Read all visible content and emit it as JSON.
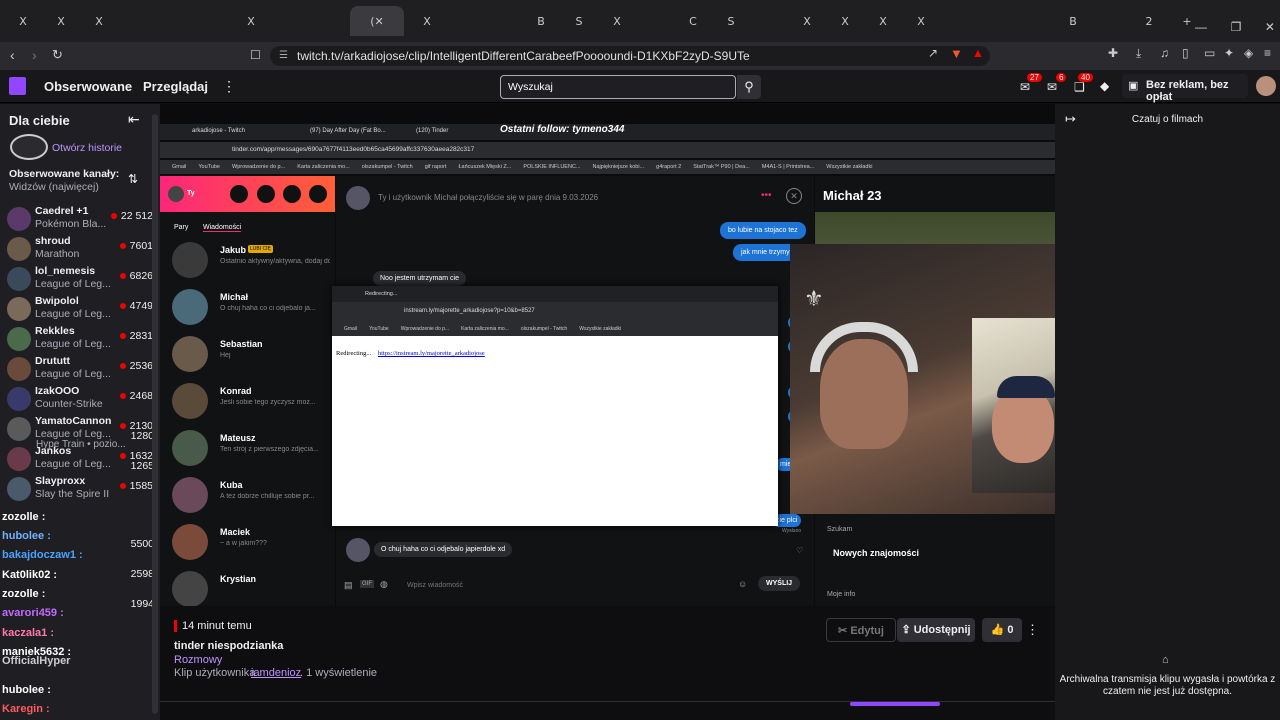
{
  "browser": {
    "tabs": [
      "X",
      "X",
      "X",
      "",
      "",
      "",
      "X",
      "",
      "",
      "X",
      "",
      "",
      "B",
      "S",
      "X",
      "",
      "C",
      "S",
      "",
      "X",
      "X",
      "X",
      "X",
      "",
      "",
      "",
      "B",
      "",
      "2"
    ],
    "active_tab_label": "(",
    "new_tab": "+",
    "url": "twitch.tv/arkadiojose/clip/IntelligentDifferentCarabeefPooooundi-D1KXbF2zyD-S9UTe",
    "window_min": "—",
    "window_max": "❐",
    "window_close": "✕"
  },
  "twitch": {
    "nav": {
      "following": "Obserwowane",
      "browse": "Przeglądaj",
      "more": "⋮"
    },
    "search_placeholder": "Wyszukaj",
    "badges": {
      "notifications": "27",
      "whispers": "6",
      "prime": "40"
    },
    "adfree": "Bez reklam, bez opłat",
    "sidebar": {
      "title": "Dla ciebie",
      "history": "Otwórz historie",
      "followed_heading": "Obserwowane kanały:",
      "sort": "Widzów (najwięcej)",
      "channels": [
        {
          "name": "Caedrel +1",
          "game": "Pokémon Bla...",
          "viewers": "22 512"
        },
        {
          "name": "shroud",
          "game": "Marathon",
          "viewers": "7601"
        },
        {
          "name": "lol_nemesis",
          "game": "League of Leg...",
          "viewers": "6826"
        },
        {
          "name": "Bwipolol",
          "game": "League of Leg...",
          "viewers": "4749"
        },
        {
          "name": "Rekkles",
          "game": "League of Leg...",
          "viewers": "2831"
        },
        {
          "name": "Drututt",
          "game": "League of Leg...",
          "viewers": "2536"
        },
        {
          "name": "IzakOOO",
          "game": "Counter-Strike",
          "viewers": "2468"
        },
        {
          "name": "YamatoCannon",
          "game": "League of Leg...",
          "viewers": "2130"
        },
        {
          "name": "Jankos",
          "game": "League of Leg...",
          "viewers": "1632"
        },
        {
          "name": "Slayproxx",
          "game": "Slay the Spire II",
          "viewers": "1585"
        }
      ],
      "hype_train": "Hype Train • pozio...",
      "extra_viewers": [
        "1280",
        "1265",
        "5500",
        "2598",
        "1994"
      ],
      "overlay_chat": [
        "zozolle :",
        "hubolee :",
        "bakajdoczaw1 :",
        "Kat0lik02 :",
        "zozolle :",
        "avarori459 :",
        "kaczala1 :",
        "maniek5632 :",
        "OfficialHyper",
        "hubolee :",
        "Karegin :"
      ]
    },
    "clip": {
      "time": "14 minut temu",
      "title": "tinder niespodzianka",
      "category": "Rozmowy",
      "author_prefix": "Klip użytkownika",
      "author": "iamdenioz",
      "views": ". 1 wyświetlenie",
      "edit": "Edytuj",
      "share": "Udostępnij",
      "likes": "0"
    },
    "right": {
      "title": "Czatuj o filmach",
      "archived": "Archiwalna transmisja klipu wygasła i powtórka z czatem nie jest już dostępna."
    }
  },
  "stream": {
    "follow_banner": "Ostatni follow: tymeno344",
    "inner_tabs": [
      "arkadiojose - Twitch",
      "(97) Day After Day (Fat Bo...",
      "(120) Tinder"
    ],
    "inner_url": "tinder.com/app/messages/690a7677f4113eed0b65ca45699affc337630aeea282c317",
    "bookmarks": [
      "Gmail",
      "YouTube",
      "Wprowadzenie do p...",
      "Karta zaliczenia mo...",
      "olszakumpel - Twitch",
      "gif raport",
      "Łańcuszek Mięski Z...",
      "POLSKIE INFLUENC...",
      "Najpiękniejsze kobi...",
      "g4raport 2",
      "StatTrak™ P90 | Dea...",
      "M4A1-S | Printstrea...",
      "Wszystkie zakładki"
    ],
    "tinder": {
      "me": "Ty",
      "tabs": [
        "Pary",
        "Wiadomości"
      ],
      "matches": [
        {
          "name": "Jakub",
          "badge": "LUBI CIĘ",
          "preview": "Ostatnio aktywny/aktywna, dodaj do par już teraz!"
        },
        {
          "name": "Michał",
          "preview": "O chuj haha co ci odjebalo ja..."
        },
        {
          "name": "Sebastian",
          "preview": "Hej"
        },
        {
          "name": "Konrad",
          "preview": "Jeśli sobie tego życzysz moż..."
        },
        {
          "name": "Mateusz",
          "preview": "Ten strój z pierwszego zdjęcia..."
        },
        {
          "name": "Kuba",
          "preview": "A tez dobrze chilluje sobie pr..."
        },
        {
          "name": "Maciek",
          "preview": "~ a w jakim???"
        },
        {
          "name": "Krystian",
          "preview": ""
        }
      ],
      "match_info": "Ty i użytkownik Michał połączyliście się w parę dnia 9.03.2026",
      "messages_out": [
        "bo lubie na stojaco tez",
        "jak mnie trzymy"
      ],
      "message_in": "Noo jestem utrzymam cie",
      "last_message": "O chuj haha co ci odjebalo japierdole xd",
      "partial_right": [
        "plu",
        "tatu",
        "sul",
        "odr",
        "miejscu",
        "cie plci"
      ],
      "sent_label": "Wysłano",
      "compose_placeholder": "Wpisz wiadomość",
      "send": "WYŚLIJ",
      "profile_name": "Michał 23",
      "looking_for_label": "Szukam",
      "looking_for": "Nowych znajomości",
      "more_info": "Moje info"
    },
    "popup": {
      "tab": "Redirecting...",
      "url": "instream.ly/majorette_arkadiojose?p=10&b=8527",
      "bookmarks": [
        "Gmail",
        "YouTube",
        "Wprowadzenie do p...",
        "Karta zaliczenia mo...",
        "olszakumpel - Twitch",
        "Wszystkie zakładki"
      ],
      "text": "Redirecting...",
      "link": "https://instream.ly/majorette_arkadiojose"
    }
  }
}
